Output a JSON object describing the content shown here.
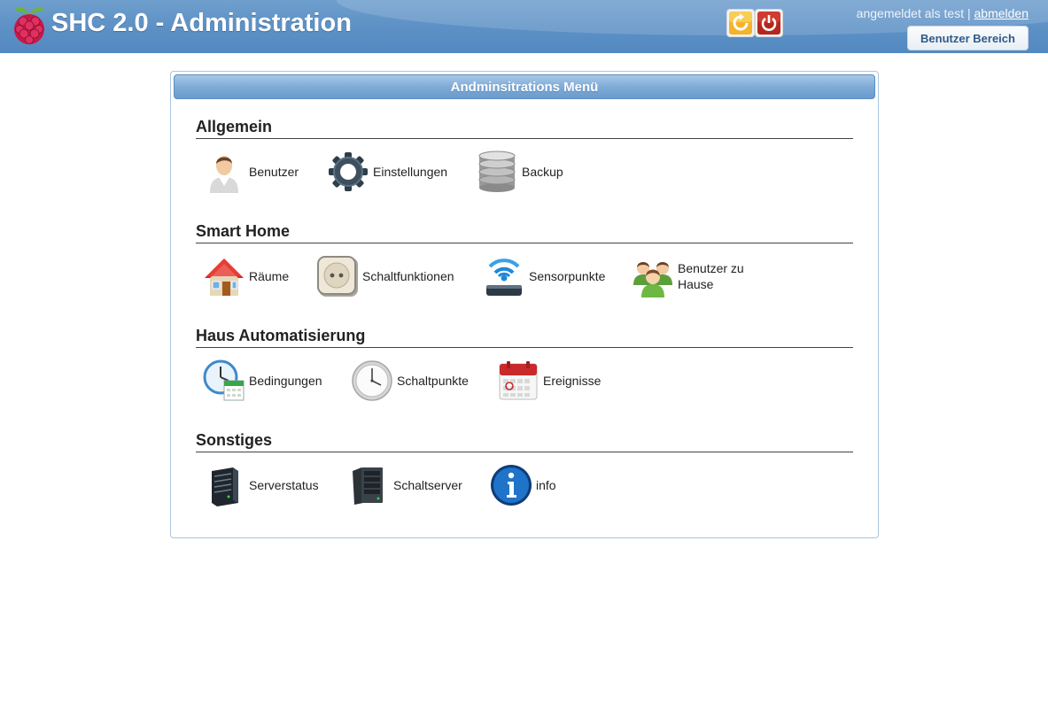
{
  "header": {
    "title": "SHC 2.0 - Administration",
    "logo_icon": "raspberry-pi-logo",
    "reload_icon": "reload-icon",
    "power_icon": "power-icon",
    "login_text": "angemeldet als test |",
    "logout_label": "abmelden",
    "user_area_label": "Benutzer Bereich"
  },
  "panel": {
    "title": "Andminsitrations Menü"
  },
  "sections": [
    {
      "title": "Allgemein",
      "items": [
        {
          "label": "Benutzer",
          "icon": "user-icon"
        },
        {
          "label": "Einstellungen",
          "icon": "gear-icon"
        },
        {
          "label": "Backup",
          "icon": "database-icon"
        }
      ]
    },
    {
      "title": "Smart Home",
      "items": [
        {
          "label": "Räume",
          "icon": "house-icon"
        },
        {
          "label": "Schaltfunktionen",
          "icon": "socket-icon"
        },
        {
          "label": "Sensorpunkte",
          "icon": "wifi-sensor-icon"
        },
        {
          "label": "Benutzer zu Hause",
          "icon": "users-group-icon"
        }
      ]
    },
    {
      "title": "Haus Automatisierung",
      "items": [
        {
          "label": "Bedingungen",
          "icon": "clock-calendar-icon"
        },
        {
          "label": "Schaltpunkte",
          "icon": "clock-icon"
        },
        {
          "label": "Ereignisse",
          "icon": "calendar-icon"
        }
      ]
    },
    {
      "title": "Sonstiges",
      "items": [
        {
          "label": "Serverstatus",
          "icon": "server-icon"
        },
        {
          "label": "Schaltserver",
          "icon": "server-rack-icon"
        },
        {
          "label": "info",
          "icon": "info-icon"
        }
      ]
    }
  ],
  "colors": {
    "header_blue": "#5f92c6",
    "panel_header_blue": "#7fabd7",
    "reload_orange": "#f0a020",
    "power_red": "#b5271e"
  }
}
